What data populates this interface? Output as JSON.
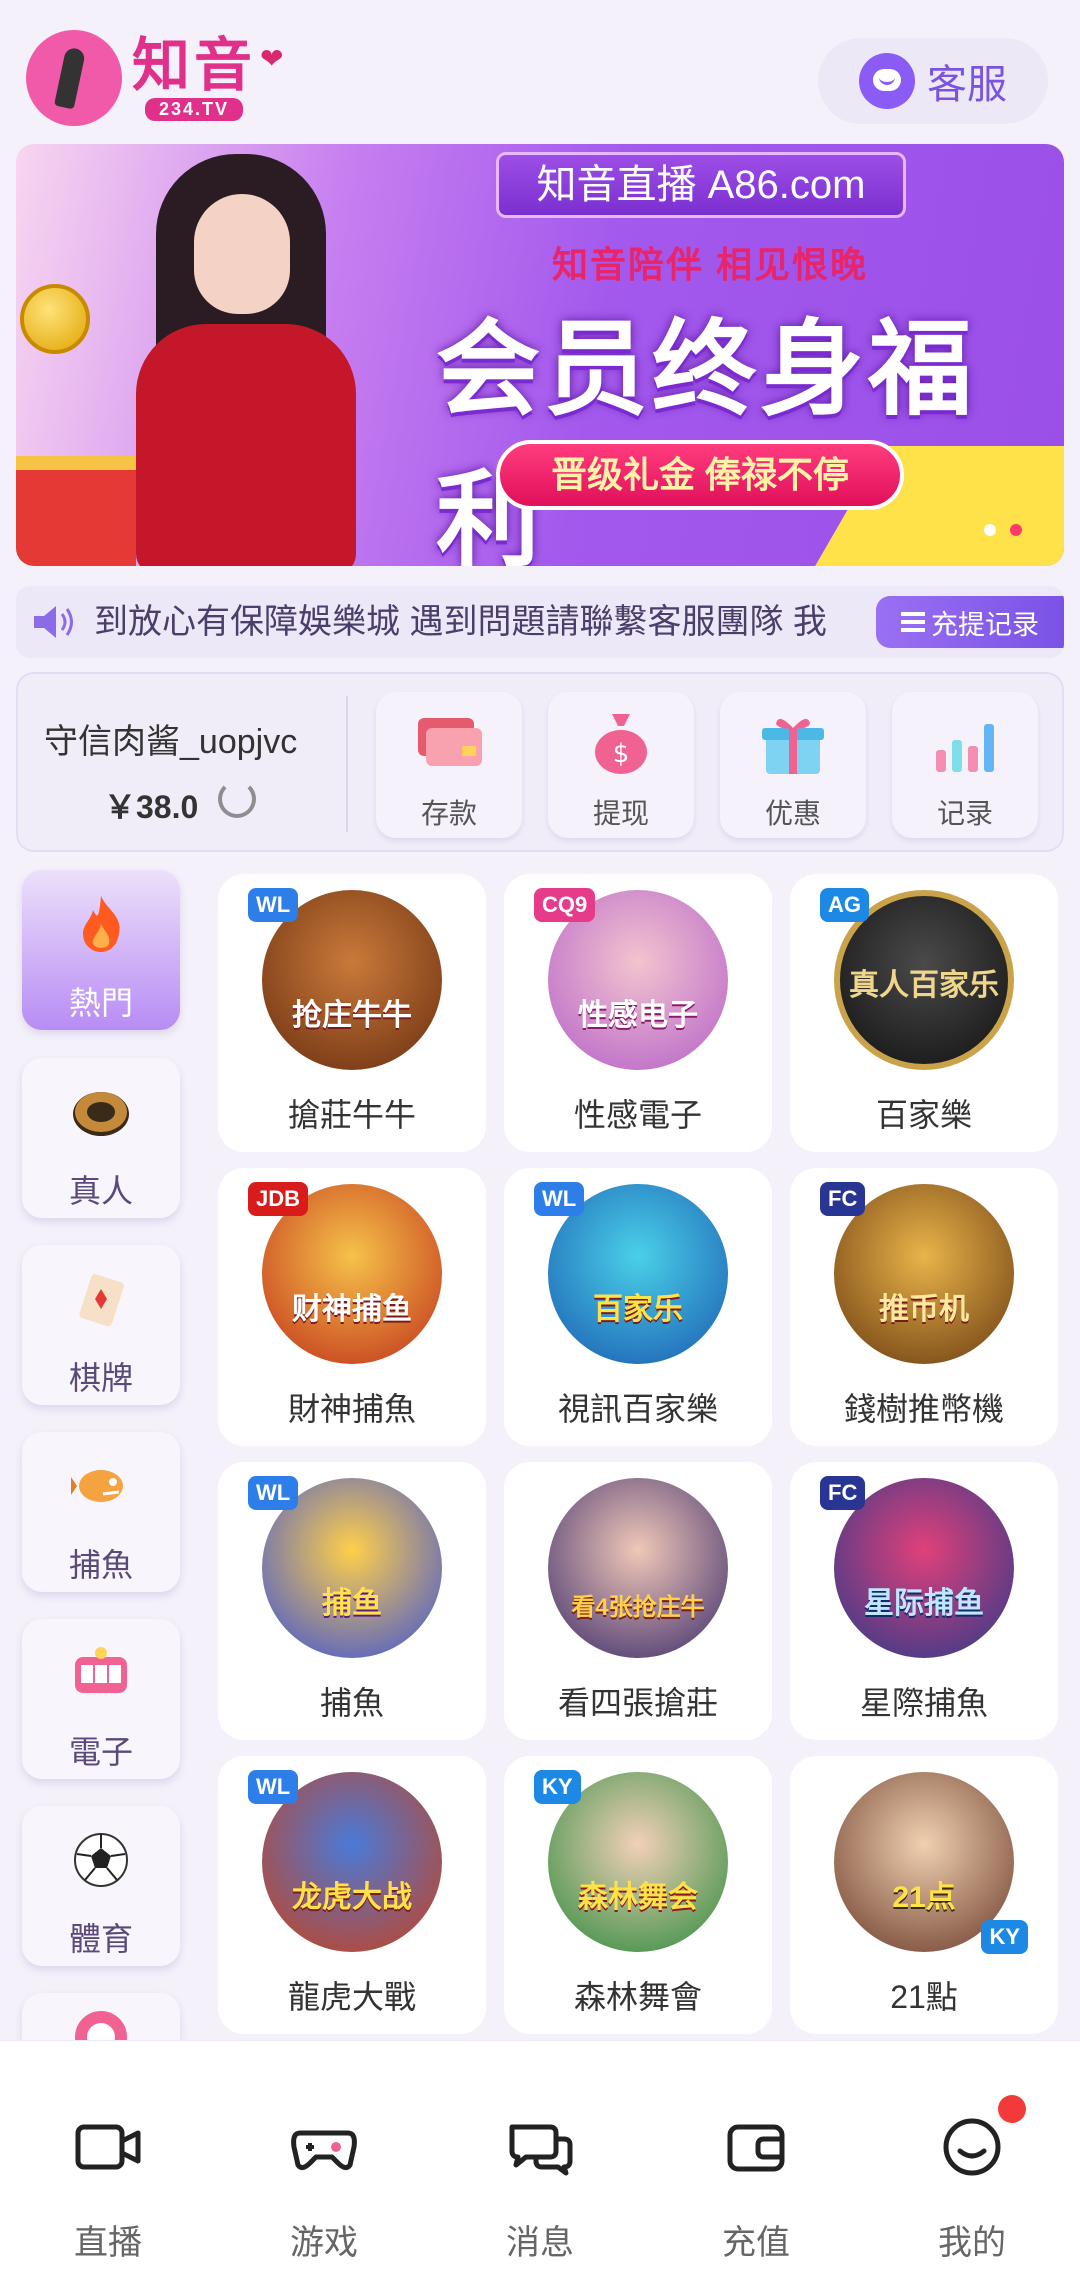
{
  "header": {
    "logo_title": "知音",
    "logo_sub": "234.TV",
    "service_label": "客服"
  },
  "banner": {
    "site": "知音直播 A86.com",
    "tagline": "知音陪伴 相见恨晚",
    "headline": "会员终身福利",
    "pill": "晋级礼金 俸禄不停"
  },
  "marquee": {
    "text": "到放心有保障娛樂城  遇到問題請聯繫客服團隊 我",
    "records_label": "充提记录"
  },
  "wallet": {
    "username": "守信肉酱_uopjvc",
    "balance": "￥38.0",
    "actions": [
      {
        "label": "存款",
        "icon": "card-icon"
      },
      {
        "label": "提现",
        "icon": "money-bag-icon"
      },
      {
        "label": "优惠",
        "icon": "gift-icon"
      },
      {
        "label": "记录",
        "icon": "bar-chart-icon"
      }
    ]
  },
  "sidebar": {
    "items": [
      {
        "label": "熱門",
        "icon": "flame-icon"
      },
      {
        "label": "真人",
        "icon": "casino-chip-icon"
      },
      {
        "label": "棋牌",
        "icon": "playing-card-icon"
      },
      {
        "label": "捕魚",
        "icon": "fish-icon"
      },
      {
        "label": "電子",
        "icon": "slot-machine-icon"
      },
      {
        "label": "體育",
        "icon": "soccer-ball-icon"
      },
      {
        "label": "",
        "icon": "lottery-ball-icon"
      }
    ]
  },
  "games": [
    {
      "name": "搶莊牛牛",
      "art": "抢庄牛牛",
      "brand": "WL"
    },
    {
      "name": "性感電子",
      "art": "性感电子",
      "brand": "CQ9"
    },
    {
      "name": "百家樂",
      "art": "真人百家乐",
      "brand": "AG"
    },
    {
      "name": "財神捕魚",
      "art": "财神捕鱼",
      "brand": "JDB"
    },
    {
      "name": "視訊百家樂",
      "art": "百家乐",
      "brand": "WL"
    },
    {
      "name": "錢樹推幣機",
      "art": "推币机",
      "brand": "FC"
    },
    {
      "name": "捕魚",
      "art": "捕鱼",
      "brand": "WL"
    },
    {
      "name": "看四張搶莊",
      "art": "看4张抢庄牛",
      "brand": ""
    },
    {
      "name": "星際捕魚",
      "art": "星际捕鱼",
      "brand": "FC"
    },
    {
      "name": "龍虎大戰",
      "art": "龙虎大战",
      "brand": "WL"
    },
    {
      "name": "森林舞會",
      "art": "森林舞会",
      "brand": "KY"
    },
    {
      "name": "21點",
      "art": "21点",
      "brand": "KY"
    }
  ],
  "bottom_nav": [
    {
      "label": "直播",
      "icon": "video-camera-icon"
    },
    {
      "label": "游戏",
      "icon": "gamepad-icon"
    },
    {
      "label": "消息",
      "icon": "chat-bubbles-icon"
    },
    {
      "label": "充值",
      "icon": "wallet-icon"
    },
    {
      "label": "我的",
      "icon": "smiley-profile-icon"
    }
  ],
  "colors": {
    "accent": "#8a5cf5",
    "brand_pink": "#e0308a",
    "background": "#f4f1fa",
    "notification": "#f23a3a"
  }
}
